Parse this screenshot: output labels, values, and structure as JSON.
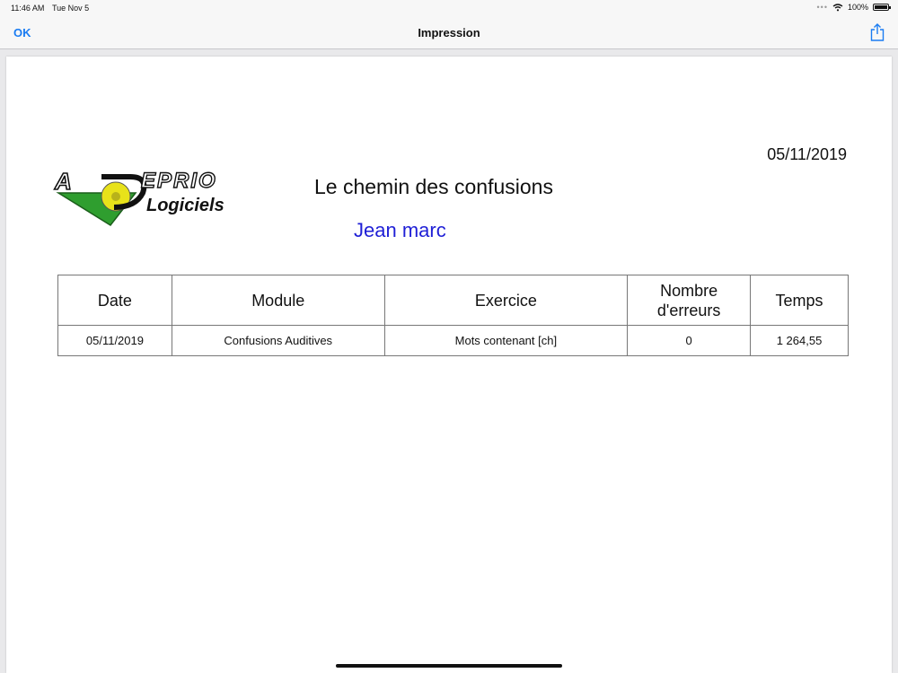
{
  "status": {
    "time": "11:46 AM",
    "date": "Tue Nov 5",
    "battery": "100%",
    "battery_level": 1.0
  },
  "nav": {
    "ok_label": "OK",
    "title": "Impression",
    "share_icon": "share-icon"
  },
  "report": {
    "date": "05/11/2019",
    "title": "Le chemin des confusions",
    "student": "Jean marc",
    "student_color": "#1f1fd6",
    "logo": {
      "line1": "ADEPRIO",
      "line2": "Logiciels",
      "colors": {
        "triangle": "#2f9e2f",
        "circle": "#e8e21a"
      }
    },
    "table": {
      "headers": [
        "Date",
        "Module",
        "Exercice",
        "Nombre\nd'erreurs",
        "Temps"
      ],
      "rows": [
        [
          "05/11/2019",
          "Confusions Auditives",
          "Mots contenant [ch]",
          "0",
          "1 264,55"
        ]
      ]
    }
  },
  "colors": {
    "accent": "#1a7cf2"
  }
}
